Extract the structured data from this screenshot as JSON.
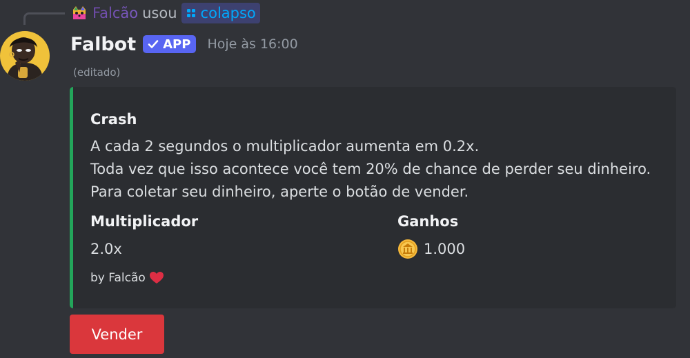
{
  "reply": {
    "user": "Falcão",
    "action": "usou",
    "command": "colapso",
    "command_icon": "slash-command-icon"
  },
  "message": {
    "author": "Falbot",
    "badge": "APP",
    "timestamp": "Hoje às 16:00",
    "edited": "(editado)"
  },
  "embed": {
    "accent_color": "#23a55a",
    "title": "Crash",
    "description": [
      "A cada 2 segundos o multiplicador aumenta em 0.2x.",
      "Toda vez que isso acontece você tem 20% de chance de perder seu dinheiro.",
      "Para coletar seu dinheiro, aperte o botão de vender."
    ],
    "fields": [
      {
        "name": "Multiplicador",
        "value": "2.0x"
      },
      {
        "name": "Ganhos",
        "value": "1.000",
        "icon": "coin-icon"
      }
    ],
    "footer": "by Falcão",
    "footer_icon": "heart-icon"
  },
  "buttons": {
    "sell_label": "Vender",
    "sell_color": "#da373c"
  },
  "colors": {
    "background": "#313338",
    "embed_background": "#2b2d31",
    "badge": "#5865f2",
    "command_link": "#00a8fc"
  }
}
